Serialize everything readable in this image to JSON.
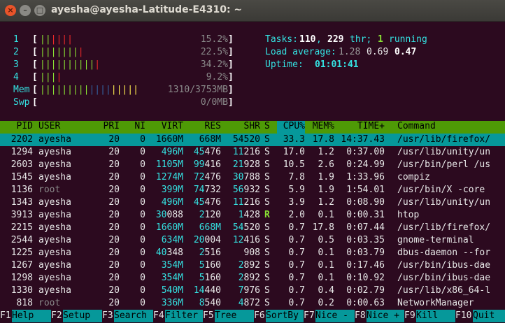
{
  "window": {
    "title": "ayesha@ayesha-Latitude-E4310: ~"
  },
  "meters": {
    "cpus": [
      {
        "label": "1",
        "bars": "||||||",
        "pct": "15.2%"
      },
      {
        "label": "2",
        "bars": "||||||||",
        "pct": "22.5%"
      },
      {
        "label": "3",
        "bars": "|||||||||||",
        "pct": "34.2%"
      },
      {
        "label": "4",
        "bars": "||||",
        "pct": "9.2%"
      }
    ],
    "mem": {
      "label": "Mem",
      "bars": "||||||||||||||||||",
      "value": "1310/3753MB"
    },
    "swp": {
      "label": "Swp",
      "value": "0/0MB"
    }
  },
  "summary": {
    "tasks_label": "Tasks:",
    "tasks_count": "110",
    "threads_count": "229",
    "threads_label": "thr;",
    "running_count": "1",
    "running_label": "running",
    "load_label": "Load average:",
    "load_1": "1.28",
    "load_5": "0.69",
    "load_15": "0.47",
    "uptime_label": "Uptime:",
    "uptime_value": "01:01:41"
  },
  "table": {
    "columns": [
      "PID",
      "USER",
      "PRI",
      "NI",
      "VIRT",
      "RES",
      "SHR",
      "S",
      "CPU%",
      "MEM%",
      "TIME+",
      "Command"
    ],
    "rows": [
      [
        "2202",
        "ayesha",
        "20",
        "0",
        "1660M",
        "668M",
        "54520",
        "S",
        "33.3",
        "17.8",
        "14:37.43",
        "/usr/lib/firefox/"
      ],
      [
        "1294",
        "ayesha",
        "20",
        "0",
        "496M",
        "45476",
        "11216",
        "S",
        "17.0",
        "1.2",
        "0:37.00",
        "/usr/lib/unity/un"
      ],
      [
        "2603",
        "ayesha",
        "20",
        "0",
        "1105M",
        "99416",
        "21928",
        "S",
        "10.5",
        "2.6",
        "0:24.99",
        "/usr/bin/perl /us"
      ],
      [
        "1545",
        "ayesha",
        "20",
        "0",
        "1274M",
        "72476",
        "30788",
        "S",
        "7.8",
        "1.9",
        "1:33.96",
        "compiz"
      ],
      [
        "1136",
        "root",
        "20",
        "0",
        "399M",
        "74732",
        "56932",
        "S",
        "5.9",
        "1.9",
        "1:54.01",
        "/usr/bin/X -core"
      ],
      [
        "1343",
        "ayesha",
        "20",
        "0",
        "496M",
        "45476",
        "11216",
        "S",
        "3.9",
        "1.2",
        "0:08.90",
        "/usr/lib/unity/un"
      ],
      [
        "3913",
        "ayesha",
        "20",
        "0",
        "30088",
        "2120",
        "1428",
        "R",
        "2.0",
        "0.1",
        "0:00.31",
        "htop"
      ],
      [
        "2215",
        "ayesha",
        "20",
        "0",
        "1660M",
        "668M",
        "54520",
        "S",
        "0.7",
        "17.8",
        "0:07.44",
        "/usr/lib/firefox/"
      ],
      [
        "2544",
        "ayesha",
        "20",
        "0",
        "634M",
        "20004",
        "12416",
        "S",
        "0.7",
        "0.5",
        "0:03.35",
        "gnome-terminal"
      ],
      [
        "1225",
        "ayesha",
        "20",
        "0",
        "40348",
        "2516",
        "908",
        "S",
        "0.7",
        "0.1",
        "0:03.79",
        "dbus-daemon --for"
      ],
      [
        "1267",
        "ayesha",
        "20",
        "0",
        "354M",
        "5160",
        "2892",
        "S",
        "0.7",
        "0.1",
        "0:17.46",
        "/usr/bin/ibus-dae"
      ],
      [
        "1298",
        "ayesha",
        "20",
        "0",
        "354M",
        "5160",
        "2892",
        "S",
        "0.7",
        "0.1",
        "0:10.92",
        "/usr/bin/ibus-dae"
      ],
      [
        "1330",
        "ayesha",
        "20",
        "0",
        "540M",
        "14440",
        "7976",
        "S",
        "0.7",
        "0.4",
        "0:02.79",
        "/usr/lib/x86_64-l"
      ],
      [
        "818",
        "root",
        "20",
        "0",
        "336M",
        "8540",
        "4872",
        "S",
        "0.7",
        "0.2",
        "0:00.63",
        "NetworkManager"
      ]
    ]
  },
  "footer": [
    {
      "key": "F1",
      "label": "Help"
    },
    {
      "key": "F2",
      "label": "Setup"
    },
    {
      "key": "F3",
      "label": "Search"
    },
    {
      "key": "F4",
      "label": "Filter"
    },
    {
      "key": "F5",
      "label": "Tree"
    },
    {
      "key": "F6",
      "label": "SortBy"
    },
    {
      "key": "F7",
      "label": "Nice -"
    },
    {
      "key": "F8",
      "label": "Nice +"
    },
    {
      "key": "F9",
      "label": "Kill"
    },
    {
      "key": "F10",
      "label": "Quit"
    }
  ],
  "colors": {
    "terminal_bg": "#2c0a1f",
    "header_bg": "#4e9a06",
    "selection_bg": "#06989a",
    "accent_cyan": "#34e2e2",
    "accent_green": "#8ae234",
    "bar_red": "#ef2929",
    "bar_yellow": "#fce94f"
  }
}
